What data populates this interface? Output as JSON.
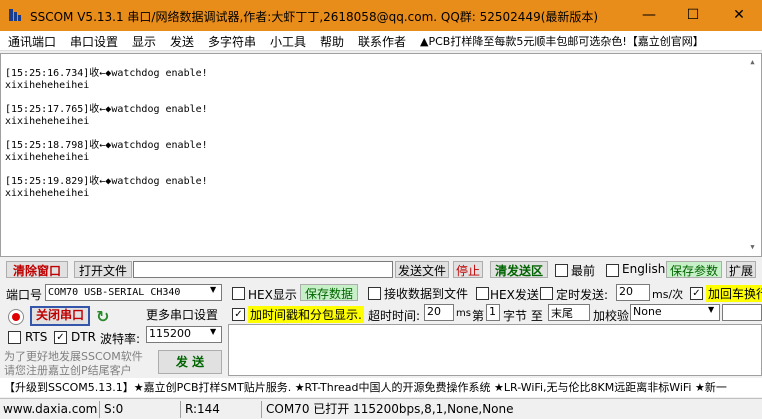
{
  "title": "SSCOM V5.13.1 串口/网络数据调试器,作者:大虾丁丁,2618058@qq.com. QQ群: 52502449(最新版本)",
  "window_buttons": {
    "minimize": "—",
    "maximize": "☐",
    "close": "✕"
  },
  "menu": [
    "通讯端口",
    "串口设置",
    "显示",
    "发送",
    "多字符串",
    "小工具",
    "帮助",
    "联系作者",
    "▲PCB打样降至每款5元顺丰包邮可选杂色!【嘉立创官网】"
  ],
  "receive_lines": [
    "[15:25:16.734]收←◆watchdog enable!",
    "xixiheheheihei",
    "[15:25:17.765]收←◆watchdog enable!",
    "xixiheheheihei",
    "[15:25:18.798]收←◆watchdog enable!",
    "xixiheheheihei",
    "[15:25:19.829]收←◆watchdog enable!",
    "xixiheheheihei"
  ],
  "toolbar": {
    "clear": "清除窗口",
    "open_file": "打开文件",
    "send_file": "发送文件",
    "stop": "停止",
    "clear_send": "清发送区",
    "topmost": "最前",
    "english": "English",
    "save_params": "保存参数",
    "expand": "扩展"
  },
  "port": {
    "label": "端口号",
    "value": "COM70 USB-SERIAL CH340",
    "hex_display": "HEX显示",
    "save_data": "保存数据",
    "recv_to_file": "接收数据到文件",
    "hex_send": "HEX发送",
    "timed_send": "定时发送:",
    "interval": "20",
    "interval_unit": "ms/次",
    "add_crlf": "加回车换行"
  },
  "controls": {
    "close_port": "关闭串口",
    "more_settings": "更多串口设置",
    "timestamp": "加时间戳和分包显示.",
    "timeout_label": "超时时间:",
    "timeout": "20",
    "timeout_unit": "ms",
    "nth_label": "第",
    "nth": "1",
    "byte_label": "字节 至",
    "end": "末尾",
    "checksum_label": "加校验",
    "checksum": "None",
    "rts": "RTS",
    "dtr": "DTR",
    "baud_label": "波特率:",
    "baud": "115200",
    "send": "发 送",
    "promo1": "为了更好地发展SSCOM软件",
    "promo2": "请您注册嘉立创P结尾客户"
  },
  "ticker": "【升级到SSCOM5.13.1】★嘉立创PCB打样SMT贴片服务. ★RT-Thread中国人的开源免费操作系统 ★LR-WiFi,无与伦比8KM远距离非标WiFi ★新一",
  "status": {
    "url": "www.daxia.com",
    "sent": "S:0",
    "received": "R:144",
    "port_state": "COM70 已打开  115200bps,8,1,None,None"
  },
  "colors": {
    "titlebar": "#e88c1a",
    "accent_red": "#c00000",
    "green": "#c8f0c8",
    "yellow": "#ffff00"
  }
}
